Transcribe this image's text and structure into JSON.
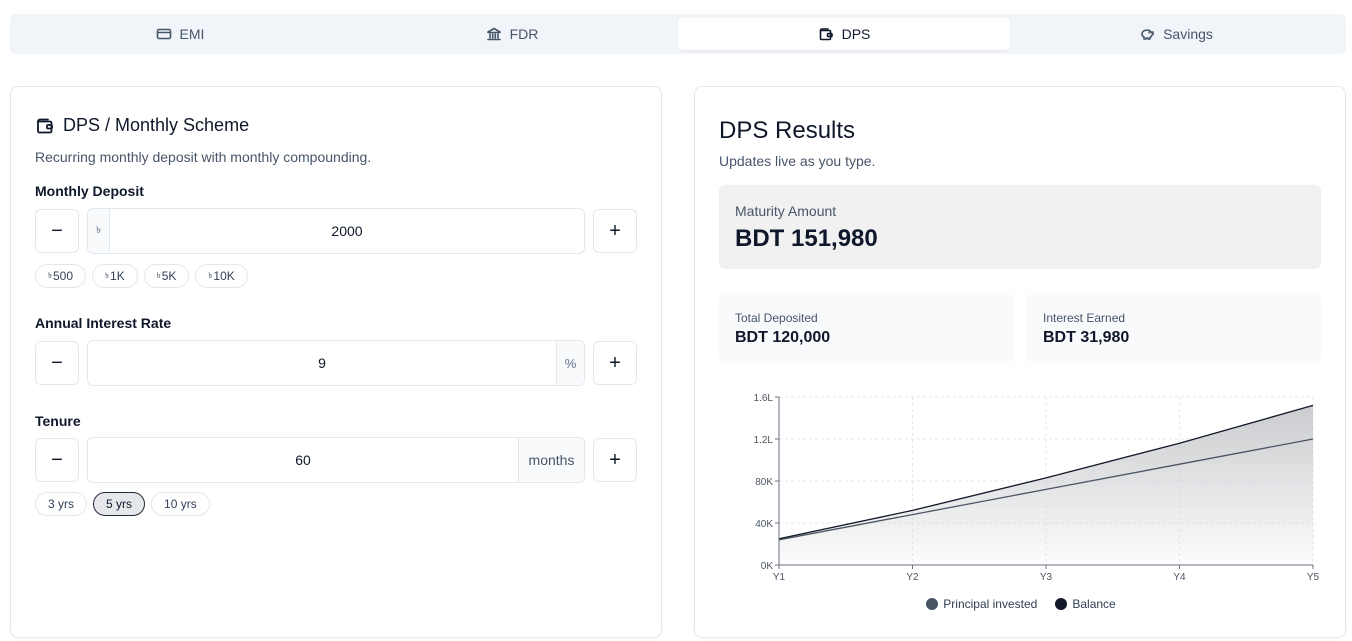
{
  "tabs": [
    {
      "label": "EMI",
      "icon": "credit-card-icon",
      "active": false
    },
    {
      "label": "FDR",
      "icon": "bank-icon",
      "active": false
    },
    {
      "label": "DPS",
      "icon": "wallet-icon",
      "active": true
    },
    {
      "label": "Savings",
      "icon": "piggy-bank-icon",
      "active": false
    }
  ],
  "form": {
    "title": "DPS / Monthly Scheme",
    "subtitle": "Recurring monthly deposit with monthly compounding.",
    "deposit": {
      "label": "Monthly Deposit",
      "prefix": "৳",
      "value": "2000",
      "minus": "−",
      "plus": "+",
      "chips": [
        "500",
        "1K",
        "5K",
        "10K"
      ],
      "chip_prefix": "৳"
    },
    "rate": {
      "label": "Annual Interest Rate",
      "value": "9",
      "suffix": "%",
      "minus": "−",
      "plus": "+"
    },
    "tenure": {
      "label": "Tenure",
      "value": "60",
      "suffix": "months",
      "minus": "−",
      "plus": "+",
      "chips": [
        "3 yrs",
        "5 yrs",
        "10 yrs"
      ],
      "selected_chip": "5 yrs"
    }
  },
  "results": {
    "title": "DPS Results",
    "subtitle": "Updates live as you type.",
    "maturity_label": "Maturity Amount",
    "maturity_value": "BDT 151,980",
    "total_deposited_label": "Total Deposited",
    "total_deposited_value": "BDT 120,000",
    "interest_label": "Interest Earned",
    "interest_value": "BDT 31,980"
  },
  "colors": {
    "principal": "#4b5563",
    "balance": "#111827",
    "area_top": "#c8c9cc",
    "grid": "#e5e7eb"
  },
  "chart_data": {
    "type": "area",
    "x": [
      "Y1",
      "Y2",
      "Y3",
      "Y4",
      "Y5"
    ],
    "y_ticks": [
      "0K",
      "40K",
      "80K",
      "1.2L",
      "1.6L"
    ],
    "y_tick_values": [
      0,
      40000,
      80000,
      120000,
      160000
    ],
    "ylim": [
      0,
      160000
    ],
    "grid": true,
    "legend_position": "bottom-center",
    "series": [
      {
        "name": "Principal invested",
        "values": [
          24000,
          48000,
          72000,
          96000,
          120000
        ]
      },
      {
        "name": "Balance",
        "values": [
          25000,
          52000,
          83000,
          116000,
          152000
        ]
      }
    ]
  }
}
